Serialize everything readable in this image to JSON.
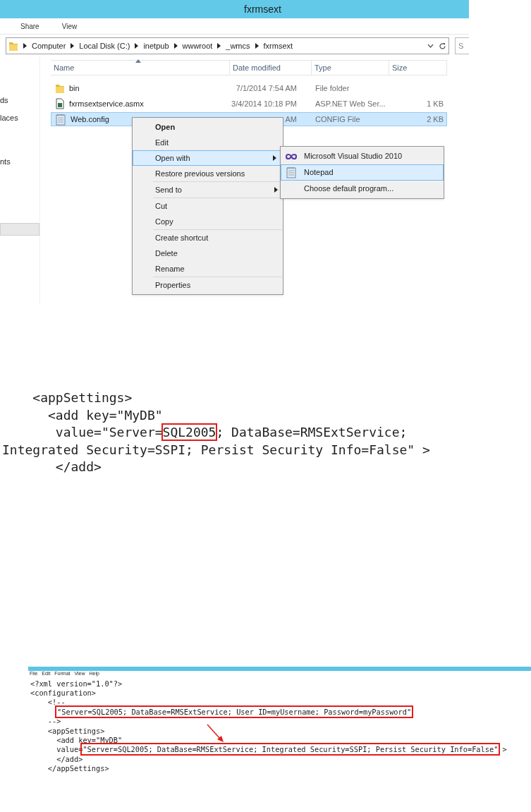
{
  "explorer": {
    "title": "fxrmsext",
    "ribbon_tabs": [
      {
        "label": "Share",
        "selected": false
      },
      {
        "label": "View",
        "selected": false
      }
    ],
    "breadcrumbs": [
      "Computer",
      "Local Disk (C:)",
      "inetpub",
      "wwwroot",
      "_wmcs",
      "fxrmsext"
    ],
    "search": {
      "placeholder": "S"
    },
    "nav_items": [
      "ds",
      "laces",
      "nts"
    ],
    "columns": [
      "Name",
      "Date modified",
      "Type",
      "Size"
    ],
    "rows": [
      {
        "kind": "folder",
        "name": "bin",
        "date": "7/1/2014 7:54 AM",
        "type": "File folder",
        "size": "",
        "selected": false
      },
      {
        "kind": "service",
        "name": "fxrmsextservice.asmx",
        "date": "3/4/2014 10:18 PM",
        "type": "ASP.NET Web Ser...",
        "size": "1 KB",
        "selected": false
      },
      {
        "kind": "config",
        "name": "Web.config",
        "date": "AM",
        "type": "CONFIG File",
        "size": "2 KB",
        "selected": true
      }
    ],
    "context_menu": {
      "groups": [
        [
          {
            "label": "Open",
            "default": true,
            "selected": false,
            "submenu": false
          },
          {
            "label": "Edit",
            "default": false,
            "selected": false,
            "submenu": false
          },
          {
            "label": "Open with",
            "default": false,
            "selected": true,
            "submenu": true
          },
          {
            "label": "Restore previous versions",
            "default": false,
            "selected": false,
            "submenu": false
          }
        ],
        [
          {
            "label": "Send to",
            "default": false,
            "selected": false,
            "submenu": true
          }
        ],
        [
          {
            "label": "Cut",
            "default": false,
            "selected": false,
            "submenu": false
          },
          {
            "label": "Copy",
            "default": false,
            "selected": false,
            "submenu": false
          }
        ],
        [
          {
            "label": "Create shortcut",
            "default": false,
            "selected": false,
            "submenu": false
          },
          {
            "label": "Delete",
            "default": false,
            "selected": false,
            "submenu": false
          },
          {
            "label": "Rename",
            "default": false,
            "selected": false,
            "submenu": false
          }
        ],
        [
          {
            "label": "Properties",
            "default": false,
            "selected": false,
            "submenu": false
          }
        ]
      ]
    },
    "submenu": [
      {
        "kind": "vs",
        "label": "Microsoft Visual Studio 2010",
        "selected": false
      },
      {
        "kind": "notepad",
        "label": "Notepad",
        "selected": true
      },
      {
        "kind": "none",
        "label": "Choose default program...",
        "selected": false
      }
    ]
  },
  "snippet": {
    "lines": [
      [
        {
          "text": "    <appSettings>",
          "boxed": false
        }
      ],
      [
        {
          "text": "      <add key=\"MyDB\"",
          "boxed": false
        }
      ],
      [
        {
          "text": "       value=\"Server=",
          "boxed": false
        },
        {
          "text": "SQL2005",
          "boxed": true
        },
        {
          "text": "; DataBase=RMSExtService;",
          "boxed": false
        }
      ],
      [
        {
          "text": "Integrated Security=SSPI; Persist Security Info=False\" >",
          "boxed": false
        }
      ],
      [
        {
          "text": "       </add>",
          "boxed": false
        }
      ]
    ]
  },
  "notepad": {
    "menu": [
      "File",
      "Edit",
      "Format",
      "View",
      "Help"
    ],
    "lines": [
      [
        {
          "text": "<?xml version=\"1.0\"?>",
          "boxed": false
        }
      ],
      [
        {
          "text": "<configuration>",
          "boxed": false
        }
      ],
      [
        {
          "text": "    <!--",
          "boxed": false
        }
      ],
      [
        {
          "text": "\"Server=SQL2005; DataBase=RMSExtService; User ID=myUsername; Password=myPassword\"",
          "boxed": true
        }
      ],
      [
        {
          "text": "    -->",
          "boxed": false
        }
      ],
      [
        {
          "text": "    <appSettings>",
          "boxed": false
        }
      ],
      [
        {
          "text": "      <add key=\"MyDB\"",
          "boxed": false
        }
      ],
      [
        {
          "text": "      value=",
          "boxed": false
        },
        {
          "text": "\"Server=SQL2005; DataBase=RMSExtService; Integrated Security=SSPI; Persist Security Info=False\"",
          "boxed": true
        },
        {
          "text": " >",
          "boxed": false
        }
      ],
      [
        {
          "text": "      </add>",
          "boxed": false
        }
      ],
      [
        {
          "text": "    </appSettings>",
          "boxed": false
        }
      ]
    ]
  }
}
